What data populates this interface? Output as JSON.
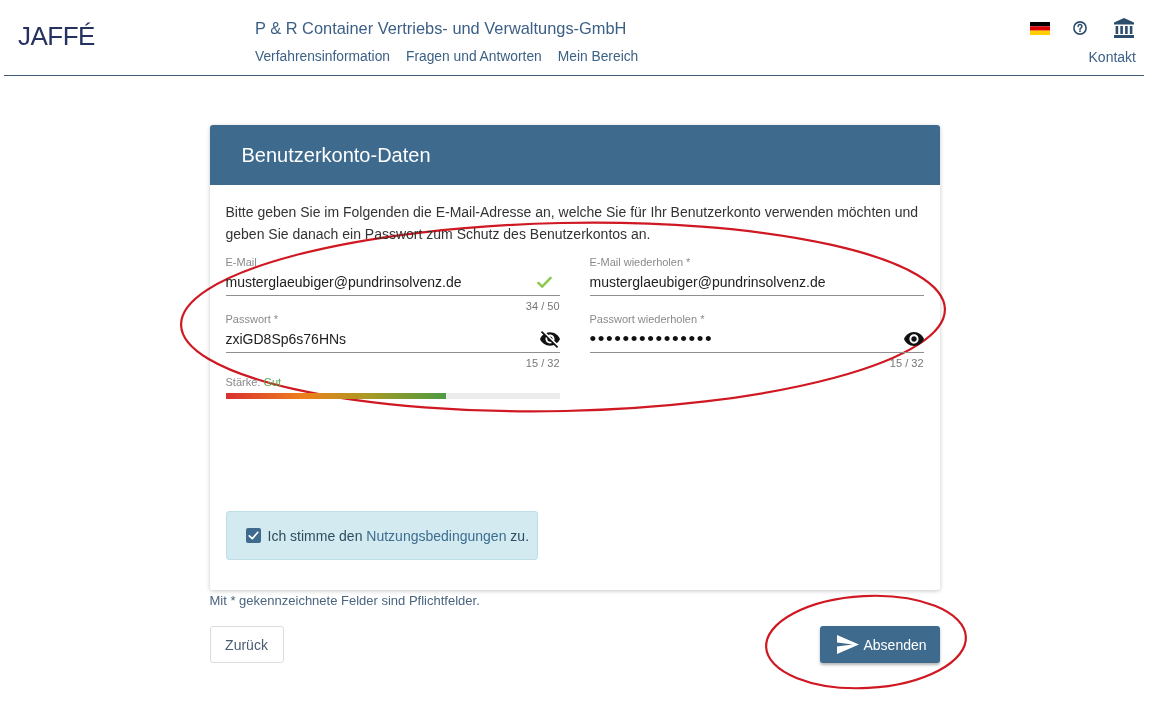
{
  "header": {
    "logo": "JAFFÉ",
    "title": "P & R Container Vertriebs- und Verwaltungs-GmbH",
    "nav": [
      {
        "label": "Verfahrensinformation"
      },
      {
        "label": "Fragen und Antworten"
      },
      {
        "label": "Mein Bereich"
      }
    ],
    "contact": "Kontakt"
  },
  "card": {
    "title": "Benutzerkonto-Daten",
    "intro": "Bitte geben Sie im Folgenden die E-Mail-Adresse an, welche Sie für Ihr Benutzerkonto verwenden möchten und geben Sie danach ein Passwort zum Schutz des Benutzerkontos an.",
    "fields": [
      {
        "kind": "email",
        "label": "E-Mail",
        "value": "musterglaeubiger@pundrinsolvenz.de",
        "counter": "34 / 50",
        "valid": true
      },
      {
        "kind": "email",
        "label": "E-Mail wiederholen *",
        "value": "musterglaeubiger@pundrinsolvenz.de",
        "valid": false
      },
      {
        "kind": "password",
        "label": "Passwort *",
        "value": "zxiGD8Sp6s76HNs",
        "counter": "15 / 32",
        "masked": false
      },
      {
        "kind": "password",
        "label": "Passwort wiederholen *",
        "value": "•••••••••••••••",
        "counter": "15 / 32",
        "masked": true
      }
    ],
    "strength": {
      "label": "Stärke:",
      "value": "Gut",
      "level": 0.66
    },
    "consent": {
      "checked": true,
      "text_before": "Ich stimme den ",
      "link": "Nutzungsbedingungen",
      "text_after": " zu."
    }
  },
  "footnote": "Mit * gekennzeichnete Felder sind Pflichtfelder.",
  "buttons": [
    {
      "kind": "back",
      "label": "Zurück"
    },
    {
      "kind": "submit",
      "label": "Absenden"
    }
  ],
  "annotations": [
    {
      "kind": "ellipse"
    },
    {
      "kind": "ellipse"
    }
  ]
}
